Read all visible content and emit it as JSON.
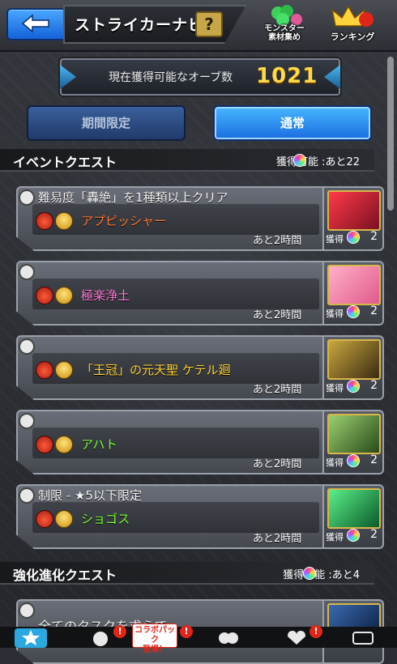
{
  "header": {
    "title": "ストライカーナビ",
    "help_label": "?",
    "icon1_label": "モンスター\n素材集め",
    "icon2_label": "ランキング"
  },
  "orb_banner": {
    "label": "現在獲得可能なオーブ数",
    "count": "1021"
  },
  "tabs": [
    {
      "label": "期間限定",
      "active": false
    },
    {
      "label": "通常",
      "active": true
    }
  ],
  "sections": [
    {
      "title": "イベントクエスト",
      "remaining": "獲得可能  :あと22"
    },
    {
      "title": "強化進化クエスト",
      "remaining": "獲得可能  :あと4"
    }
  ],
  "quests": [
    {
      "title": "難易度「轟絶」を1種類以上クリア",
      "boss": "アプピッシャー",
      "boss_color": "#ff7a3a",
      "time_left": "あと2時間",
      "reward_label": "獲得",
      "reward_count": "2",
      "portrait_colors": [
        "#ff3a4a",
        "#7a1020"
      ]
    },
    {
      "title": "",
      "boss": "極楽浄土",
      "boss_color": "#ff7ad9",
      "time_left": "あと2時間",
      "reward_label": "獲得",
      "reward_count": "2",
      "portrait_colors": [
        "#ffb0c8",
        "#e05a8a"
      ]
    },
    {
      "title": "",
      "boss": "「王冠」の元天聖 ケテル廻",
      "boss_color": "#ffd23a",
      "time_left": "あと2時間",
      "reward_label": "獲得",
      "reward_count": "2",
      "portrait_colors": [
        "#c9a840",
        "#3a2a10"
      ]
    },
    {
      "title": "",
      "boss": "アハト",
      "boss_color": "#7cff3a",
      "time_left": "あと2時間",
      "reward_label": "獲得",
      "reward_count": "2",
      "portrait_colors": [
        "#9ad070",
        "#2a4a1a"
      ]
    },
    {
      "title": "制限 - ★5以下限定",
      "boss": "ショゴス",
      "boss_color": "#7cff3a",
      "time_left": "あと2時間",
      "reward_label": "獲得",
      "reward_count": "2",
      "portrait_colors": [
        "#5cf08a",
        "#0a5a2a"
      ]
    },
    {
      "title": "全てのタスクを求らて",
      "boss": "",
      "boss_color": "#ffffff",
      "time_left": "",
      "reward_label": "",
      "reward_count": "",
      "portrait_colors": [
        "#3a6ab0",
        "#0a1a3a"
      ]
    }
  ],
  "bottom_bar": {
    "collab_label": "コラボパック\n登場！",
    "badge": "!"
  },
  "colors": {
    "accent": "#1a6de0",
    "gold": "#ffd84a"
  }
}
